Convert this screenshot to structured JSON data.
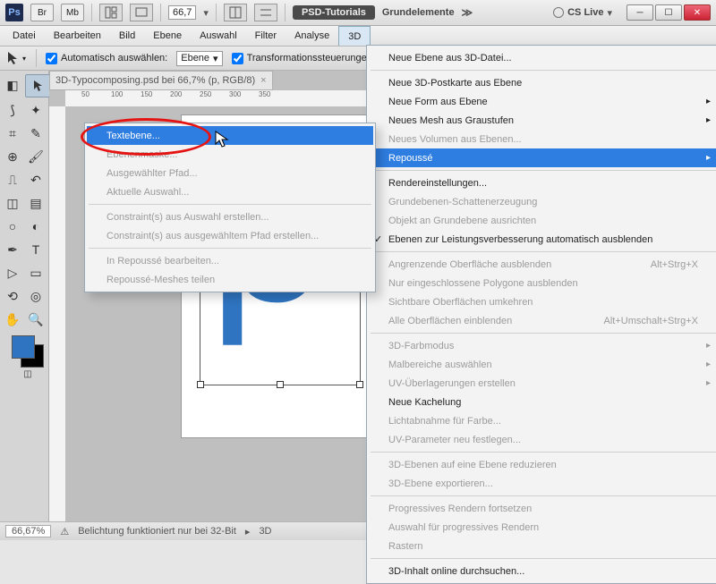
{
  "titlebar": {
    "ps": "Ps",
    "br": "Br",
    "mb": "Mb",
    "zoom": "66,7",
    "psd_tutorials": "PSD-Tutorials",
    "grundelemente": "Grundelemente",
    "more": "≫",
    "cslive": "CS Live"
  },
  "menubar": {
    "datei": "Datei",
    "bearbeiten": "Bearbeiten",
    "bild": "Bild",
    "ebene": "Ebene",
    "auswahl": "Auswahl",
    "filter": "Filter",
    "analyse": "Analyse",
    "3d": "3D"
  },
  "optbar": {
    "auto_select": "Automatisch auswählen:",
    "target": "Ebene",
    "transform": "Transformationssteuerunge"
  },
  "doc": {
    "tab": "3D-Typocomposing.psd bei 66,7% (p, RGB/8)",
    "ruler_labels": [
      "50",
      "100",
      "150",
      "200",
      "250",
      "300",
      "350"
    ]
  },
  "status": {
    "zoom": "66,67%",
    "msg": "Belichtung funktioniert nur bei 32-Bit",
    "extra": "3D"
  },
  "menu3d": {
    "neue_ebene": "Neue Ebene aus 3D-Datei...",
    "postkarte": "Neue 3D-Postkarte aus Ebene",
    "form": "Neue Form aus Ebene",
    "mesh": "Neues Mesh aus Graustufen",
    "volumen": "Neues Volumen aus Ebenen...",
    "repousse": "Repoussé",
    "rendereinst": "Rendereinstellungen...",
    "schatten": "Grundebenen-Schattenerzeugung",
    "ausrichten": "Objekt an Grundebene ausrichten",
    "auto_ausblenden": "Ebenen zur Leistungsverbesserung automatisch ausblenden",
    "angrenz": "Angrenzende Oberfläche ausblenden",
    "angrenz_short": "Alt+Strg+X",
    "polygone": "Nur eingeschlossene Polygone ausblenden",
    "umkehren": "Sichtbare Oberflächen umkehren",
    "alle_einbl": "Alle Oberflächen einblenden",
    "alle_einbl_short": "Alt+Umschalt+Strg+X",
    "farbmodus": "3D-Farbmodus",
    "malbereiche": "Malbereiche auswählen",
    "uv_erstellen": "UV-Überlagerungen erstellen",
    "kachelung": "Neue Kachelung",
    "lichtabnahme": "Lichtabnahme für Farbe...",
    "uv_param": "UV-Parameter neu festlegen...",
    "reduzieren": "3D-Ebenen auf eine Ebene reduzieren",
    "exportieren": "3D-Ebene exportieren...",
    "prog_fortsetzen": "Progressives Rendern fortsetzen",
    "prog_auswahl": "Auswahl für progressives Rendern",
    "rastern": "Rastern",
    "online": "3D-Inhalt online durchsuchen..."
  },
  "repousse": {
    "textebene": "Textebene...",
    "ebenenmaske": "Ebenenmaske...",
    "pfad": "Ausgewählter Pfad...",
    "auswahl": "Aktuelle Auswahl...",
    "constr_auswahl": "Constraint(s) aus Auswahl erstellen...",
    "constr_pfad": "Constraint(s) aus ausgewähltem Pfad erstellen...",
    "bearbeiten": "In Repoussé bearbeiten...",
    "meshes": "Repoussé-Meshes teilen"
  }
}
